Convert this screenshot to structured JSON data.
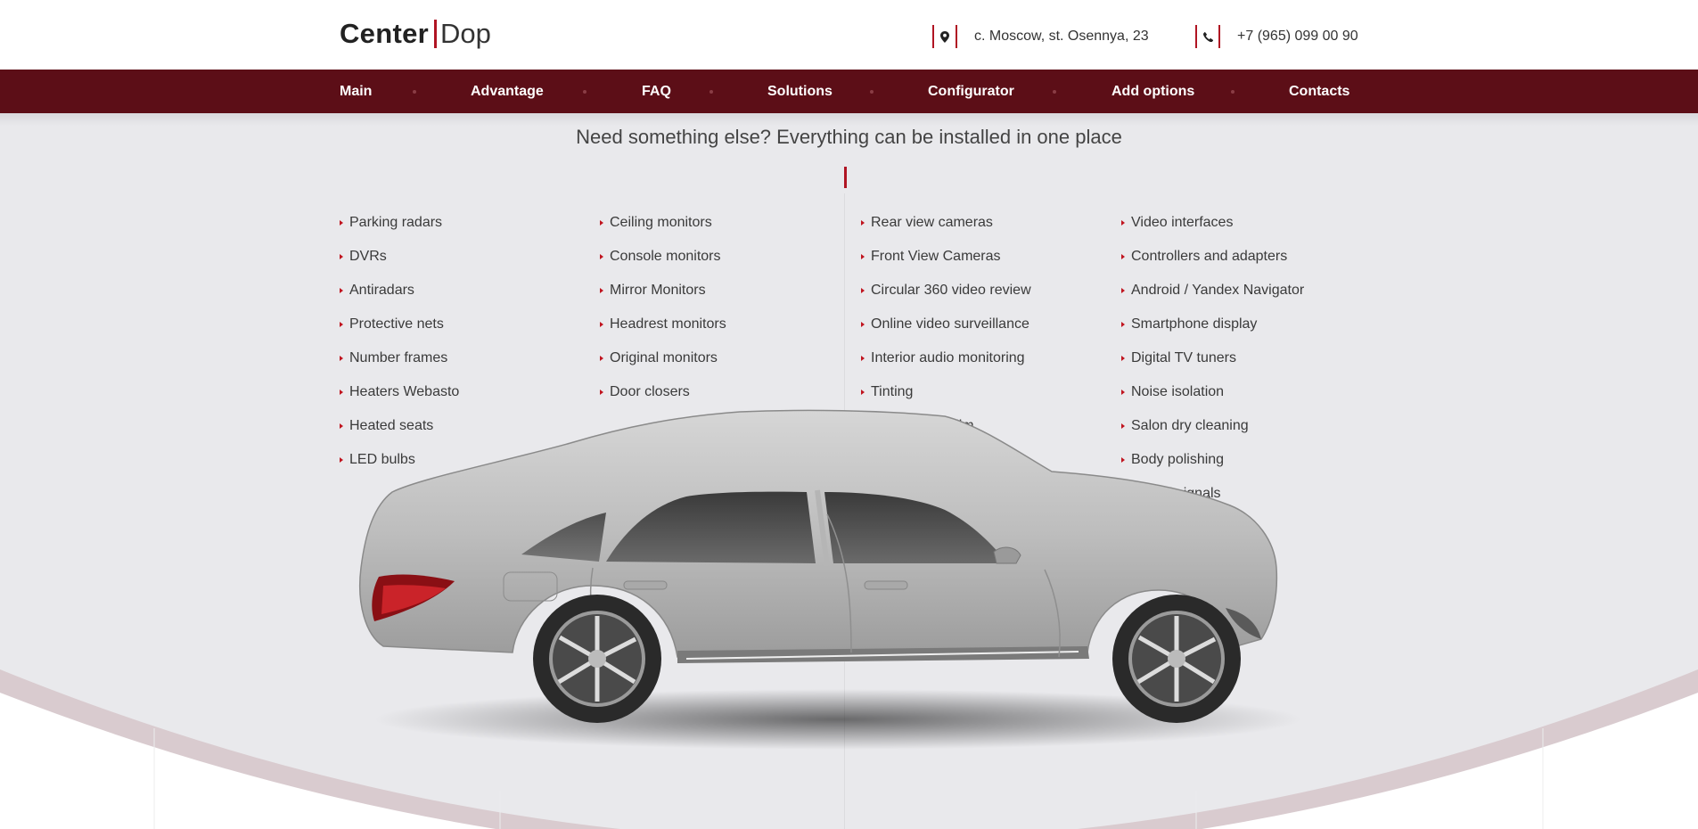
{
  "header": {
    "logo_part1": "Center",
    "logo_part2": "Dop",
    "address": "c. Moscow, st. Osennya, 23",
    "phone": "+7 (965) 099 00 90"
  },
  "nav": {
    "items": [
      "Main",
      "Advantage",
      "FAQ",
      "Solutions",
      "Configurator",
      "Add options",
      "Contacts"
    ]
  },
  "section": {
    "subtitle": "Need something else? Everything can be installed in one place"
  },
  "columns": [
    [
      "Parking radars",
      "DVRs",
      "Antiradars",
      "Protective nets",
      "Number frames",
      "Heaters Webasto",
      "Heated seats",
      "LED bulbs"
    ],
    [
      "Ceiling monitors",
      "Console monitors",
      "Mirror Monitors",
      "Headrest monitors",
      "Original monitors",
      "Door closers"
    ],
    [
      "Rear view cameras",
      "Front View Cameras",
      "Circular 360 video review",
      "Online video surveillance",
      "Interior audio monitoring",
      "Tinting",
      "Pasting with film"
    ],
    [
      "Video interfaces",
      "Controllers and adapters",
      "Android / Yandex Navigator",
      "Smartphone display",
      "Digital TV tuners",
      "Noise isolation",
      "Salon dry cleaning",
      "Body polishing",
      "Sound signals"
    ]
  ],
  "colors": {
    "nav_bg": "#5c0e17",
    "accent": "#b01423",
    "section_bg": "#e9e9ec"
  },
  "icons": {
    "address": "map-pin-icon",
    "phone": "phone-icon",
    "bullet": "triangle-bullet-icon"
  }
}
